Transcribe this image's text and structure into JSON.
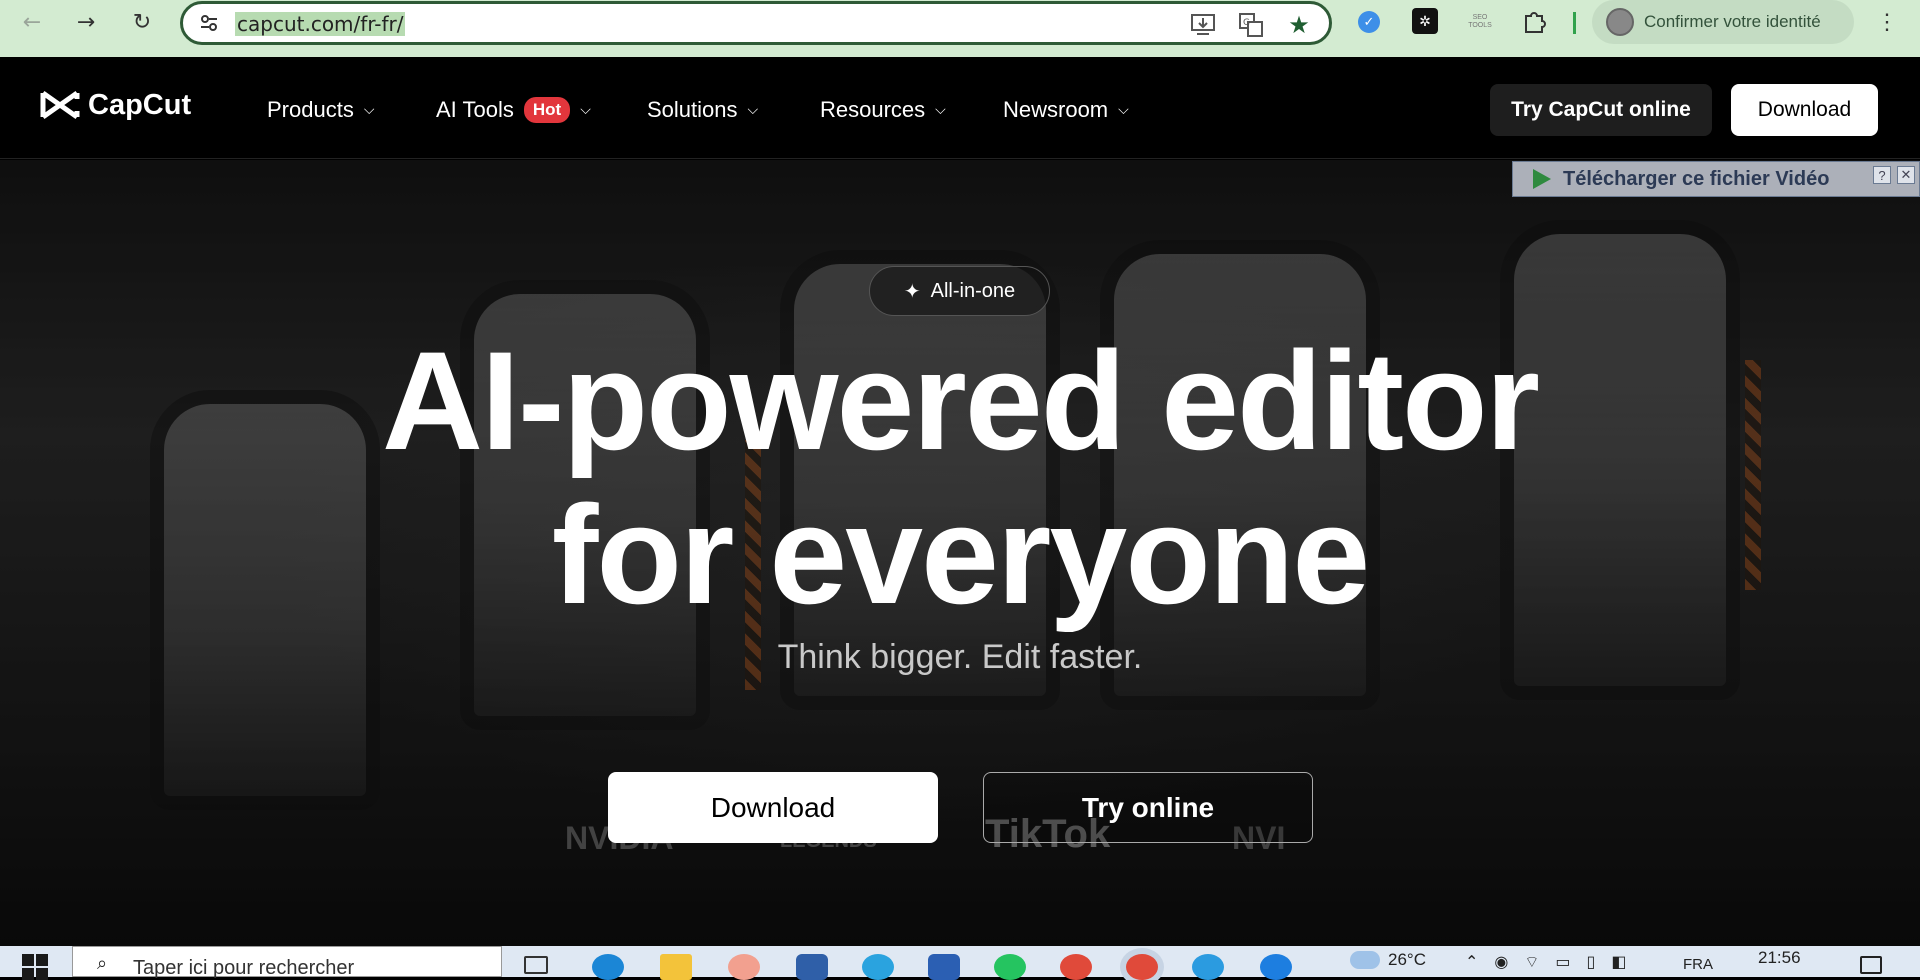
{
  "browser": {
    "url": "capcut.com/fr-fr/",
    "profile_label": "Confirmer votre identité",
    "icons": [
      "back-icon",
      "forward-icon",
      "reload-icon",
      "site-info-icon",
      "install-icon",
      "translate-icon",
      "star-icon",
      "puzzle-icon",
      "kebab-icon"
    ],
    "ext_seo_label": "SEO TOOLS"
  },
  "header": {
    "logo_text": "CapCut",
    "nav": [
      {
        "label": "Products"
      },
      {
        "label": "AI Tools",
        "badge": "Hot"
      },
      {
        "label": "Solutions"
      },
      {
        "label": "Resources"
      },
      {
        "label": "Newsroom"
      }
    ],
    "try_online_label": "Try CapCut online",
    "download_label": "Download"
  },
  "hero": {
    "badge": "All-in-one",
    "headline_line1": "AI-powered editor",
    "headline_line2": "for everyone",
    "tagline": "Think bigger. Edit faster.",
    "download_label": "Download",
    "try_online_label": "Try online",
    "partners": [
      "NVIDIA",
      "LEGENDS",
      "TikTok",
      "NVI"
    ]
  },
  "video_widget": {
    "label": "Télécharger ce fichier Vidéo",
    "help": "?",
    "close": "✕"
  },
  "taskbar": {
    "search_placeholder": "Taper ici pour rechercher",
    "weather": "26°C",
    "lang": "FRA",
    "time": "21:56"
  },
  "colors": {
    "browser_bg": "#d3ebd1",
    "omnibox_border": "#2e5a36",
    "hot_badge": "#e2363c",
    "page_bg": "#000000"
  }
}
